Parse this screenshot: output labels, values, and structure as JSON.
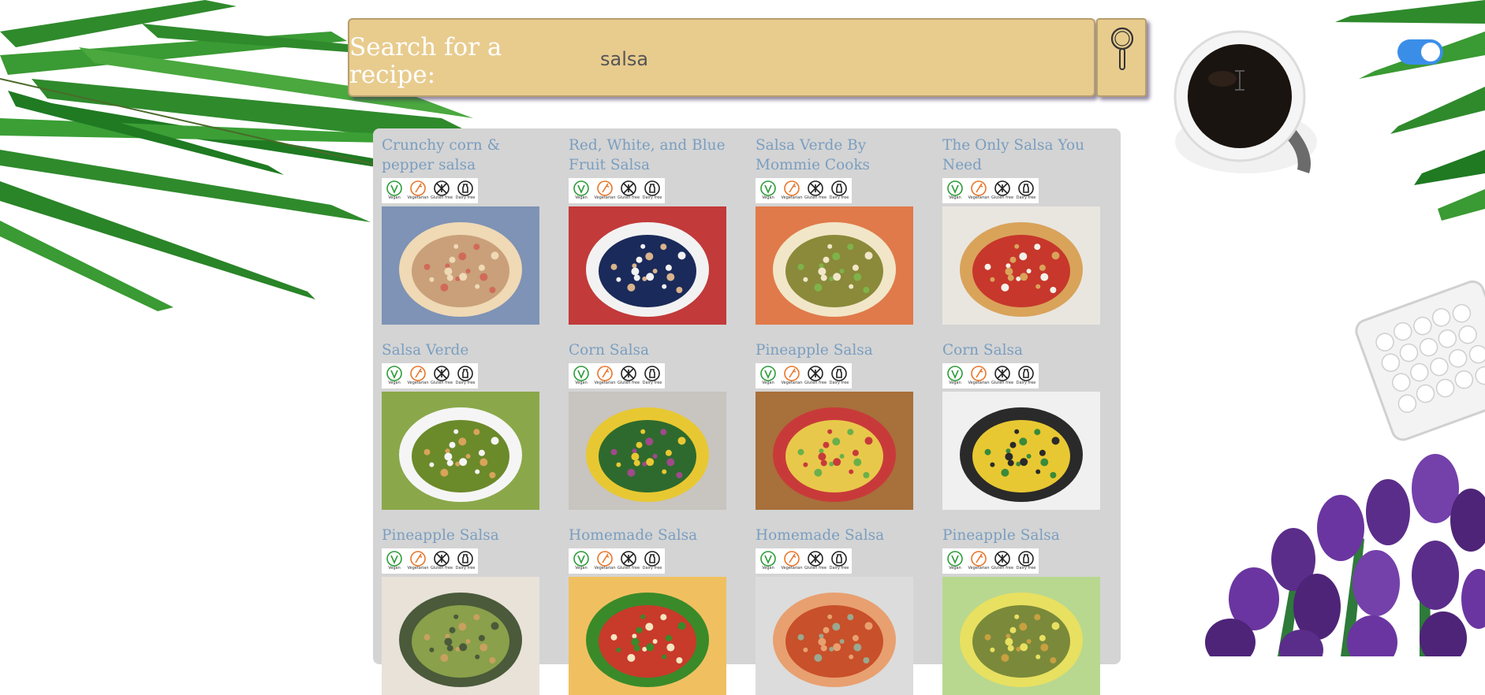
{
  "search": {
    "label": "Search for a recipe:",
    "value": "salsa",
    "toggle_on": true
  },
  "diet_badges": [
    {
      "icon": "vegan-icon",
      "label": "Vegan",
      "color": "#2e9c3a"
    },
    {
      "icon": "vegetarian-icon",
      "label": "Vegetarian",
      "color": "#e8762b"
    },
    {
      "icon": "gluten-free-icon",
      "label": "Gluten free",
      "color": "#222222"
    },
    {
      "icon": "dairy-free-icon",
      "label": "Dairy free",
      "color": "#222222"
    }
  ],
  "recipes": [
    {
      "title": "Crunchy corn & pepper salsa",
      "image": "salsa-corn-pepper-photo"
    },
    {
      "title": "Red, White, and Blue Fruit Salsa",
      "image": "fruit-salsa-photo"
    },
    {
      "title": "Salsa Verde By Mommie Cooks",
      "image": "salsa-verde-glass-photo"
    },
    {
      "title": "The Only Salsa You Need",
      "image": "red-salsa-chips-photo"
    },
    {
      "title": "Salsa Verde",
      "image": "salsa-verde-bowl-photo"
    },
    {
      "title": "Corn Salsa",
      "image": "corn-salsa-ingredients-photo"
    },
    {
      "title": "Pineapple Salsa",
      "image": "pineapple-salsa-photo"
    },
    {
      "title": "Corn Salsa",
      "image": "corn-bean-salsa-photo"
    },
    {
      "title": "Pineapple Salsa",
      "image": "pineapple-salsa-bowl-photo"
    },
    {
      "title": "Homemade Salsa",
      "image": "homemade-salsa-jalapeno-photo"
    },
    {
      "title": "Homemade Salsa",
      "image": "homemade-salsa-bowl-photo"
    },
    {
      "title": "Pineapple Salsa",
      "image": "pineapple-salsa-lime-photo"
    }
  ]
}
